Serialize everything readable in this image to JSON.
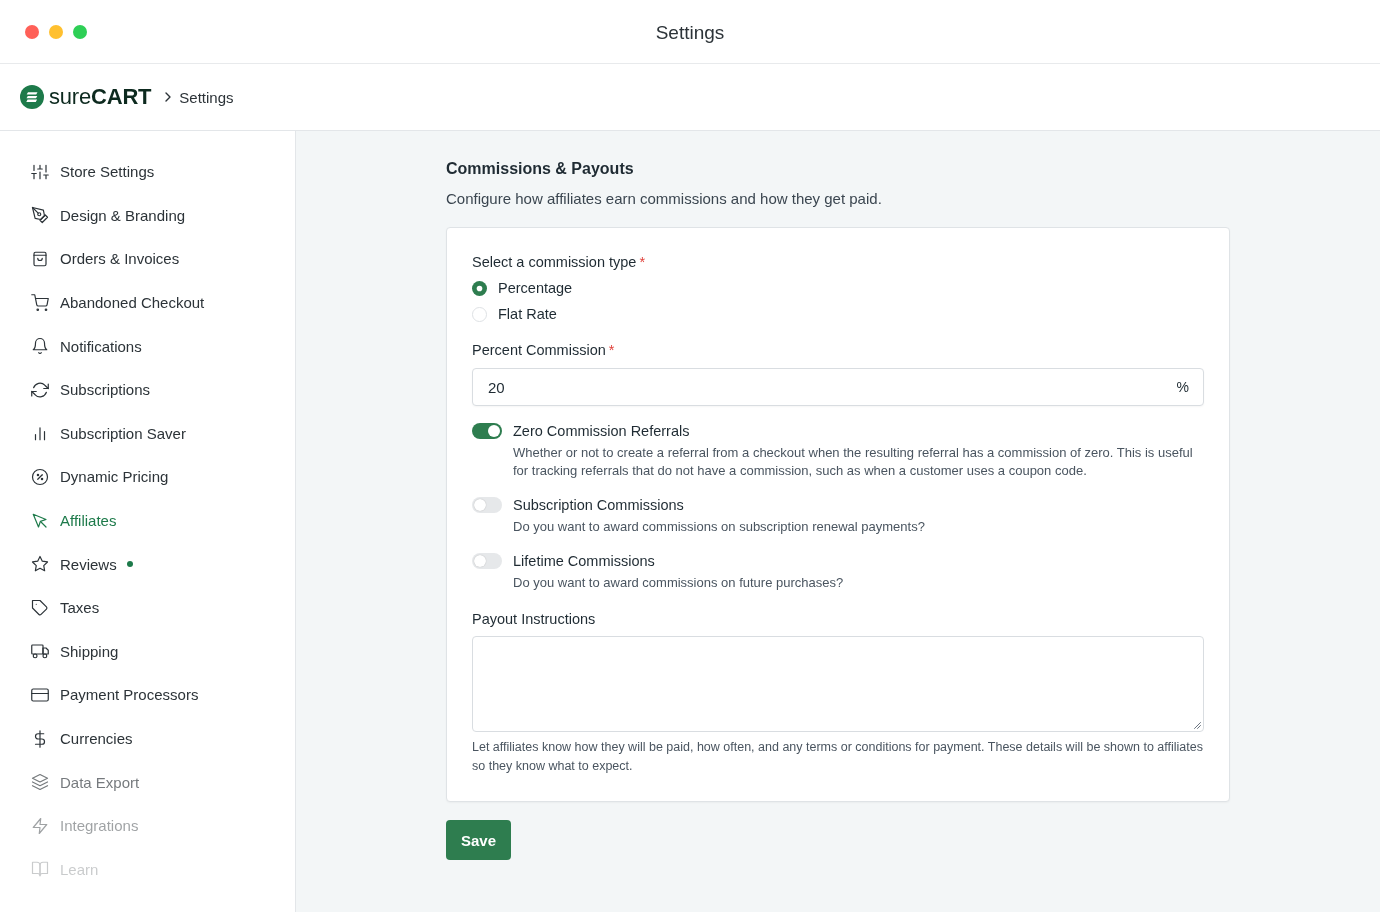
{
  "window": {
    "title": "Settings"
  },
  "header": {
    "logo_text": "sure**CART**",
    "breadcrumb": {
      "current": "Settings"
    }
  },
  "sidebar": {
    "items": [
      {
        "label": "Store Settings",
        "selected": false,
        "new": false,
        "faded": false
      },
      {
        "label": "Design & Branding",
        "selected": false,
        "new": false,
        "faded": false
      },
      {
        "label": "Orders & Invoices",
        "selected": false,
        "new": false,
        "faded": false
      },
      {
        "label": "Abandoned Checkout",
        "selected": false,
        "new": false,
        "faded": false
      },
      {
        "label": "Notifications",
        "selected": false,
        "new": false,
        "faded": false
      },
      {
        "label": "Subscriptions",
        "selected": false,
        "new": false,
        "faded": false
      },
      {
        "label": "Subscription Saver",
        "selected": false,
        "new": false,
        "faded": false
      },
      {
        "label": "Dynamic Pricing",
        "selected": false,
        "new": false,
        "faded": false
      },
      {
        "label": "Affiliates",
        "selected": true,
        "new": false,
        "faded": false
      },
      {
        "label": "Reviews",
        "selected": false,
        "new": true,
        "faded": false
      },
      {
        "label": "Taxes",
        "selected": false,
        "new": false,
        "faded": false
      },
      {
        "label": "Shipping",
        "selected": false,
        "new": false,
        "faded": false
      },
      {
        "label": "Payment Processors",
        "selected": false,
        "new": false,
        "faded": false
      },
      {
        "label": "Currencies",
        "selected": false,
        "new": false,
        "faded": false
      },
      {
        "label": "Data Export",
        "selected": false,
        "new": false,
        "faded": true
      },
      {
        "label": "Integrations",
        "selected": false,
        "new": false,
        "faded": true
      },
      {
        "label": "Learn",
        "selected": false,
        "new": false,
        "faded": true
      }
    ]
  },
  "section": {
    "title": "Commissions & Payouts",
    "description": "Configure how affiliates earn commissions and how they get paid."
  },
  "form": {
    "commission_type": {
      "label": "Select a commission type",
      "required_mark": "*",
      "options": [
        {
          "label": "Percentage",
          "selected": true
        },
        {
          "label": "Flat Rate",
          "selected": false
        }
      ]
    },
    "percent_commission": {
      "label": "Percent Commission",
      "required_mark": "*",
      "value": "20",
      "suffix": "%"
    },
    "toggles": [
      {
        "label": "Zero Commission Referrals",
        "description": "Whether or not to create a referral from a checkout when the resulting referral has a commission of zero. This is useful for tracking referrals that do not have a commission, such as when a customer uses a coupon code.",
        "on": true
      },
      {
        "label": "Subscription Commissions",
        "description": "Do you want to award commissions on subscription renewal payments?",
        "on": false
      },
      {
        "label": "Lifetime Commissions",
        "description": "Do you want to award commissions on future purchases?",
        "on": false
      }
    ],
    "payout_instructions": {
      "label": "Payout Instructions",
      "help": "Let affiliates know how they will be paid, how often, and any terms or conditions for payment. These details will be shown to affiliates so they know what to expect."
    }
  },
  "save_button": {
    "label": "Save"
  }
}
